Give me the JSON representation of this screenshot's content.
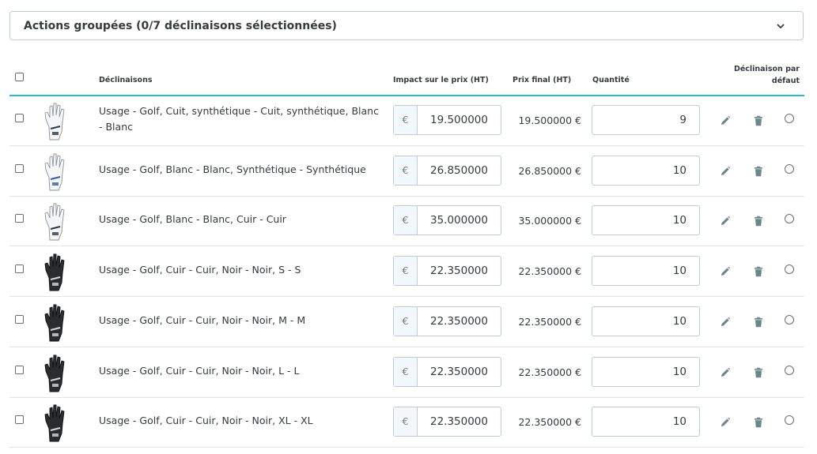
{
  "bulk": {
    "title": "Actions groupées (0/7 déclinaisons sélectionnées)"
  },
  "table": {
    "headers": {
      "combinations": "Déclinaisons",
      "impact": "Impact sur le prix (HT)",
      "final_price": "Prix final (HT)",
      "quantity": "Quantité",
      "default_line1": "Déclinaison par",
      "default_line2": "défaut"
    },
    "currency": "€",
    "rows": [
      {
        "name": "Usage - Golf, Cuit, synthétique - Cuit, synthétique, Blanc - Blanc",
        "impact": "19.500000",
        "final": "19.500000 €",
        "qty": "9",
        "thumb": "white-glove"
      },
      {
        "name": "Usage - Golf, Blanc - Blanc, Synthétique - Synthétique",
        "impact": "26.850000",
        "final": "26.850000 €",
        "qty": "10",
        "thumb": "white-blue-glove"
      },
      {
        "name": "Usage - Golf, Blanc - Blanc, Cuir - Cuir",
        "impact": "35.000000",
        "final": "35.000000 €",
        "qty": "10",
        "thumb": "white-glove"
      },
      {
        "name": "Usage - Golf, Cuir - Cuir, Noir - Noir, S - S",
        "impact": "22.350000",
        "final": "22.350000 €",
        "qty": "10",
        "thumb": "black-glove"
      },
      {
        "name": "Usage - Golf, Cuir - Cuir, Noir - Noir, M - M",
        "impact": "22.350000",
        "final": "22.350000 €",
        "qty": "10",
        "thumb": "black-glove"
      },
      {
        "name": "Usage - Golf, Cuir - Cuir, Noir - Noir, L - L",
        "impact": "22.350000",
        "final": "22.350000 €",
        "qty": "10",
        "thumb": "black-glove"
      },
      {
        "name": "Usage - Golf, Cuir - Cuir, Noir - Noir, XL - XL",
        "impact": "22.350000",
        "final": "22.350000 €",
        "qty": "10",
        "thumb": "black-glove"
      }
    ]
  },
  "colors": {
    "border": "#bbcdd2",
    "header_line": "#25b9d7",
    "text": "#363a41",
    "icon": "#6c868e"
  }
}
